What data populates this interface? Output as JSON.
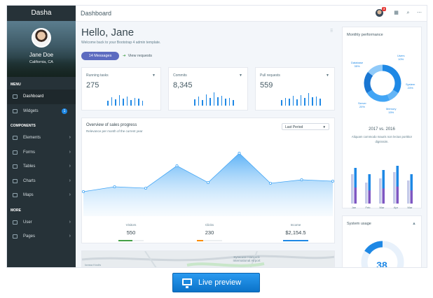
{
  "app": {
    "brand": "Dasha",
    "page_title": "Dashboard"
  },
  "user": {
    "name": "Jane Doe",
    "location": "California, CA",
    "notifications": "3"
  },
  "sidebar": {
    "menu_header": "MENU",
    "components_header": "COMPONENTS",
    "more_header": "MORE",
    "items": [
      {
        "label": "Dashboard"
      },
      {
        "label": "Widgets",
        "badge": "1"
      },
      {
        "label": "Elements"
      },
      {
        "label": "Forms"
      },
      {
        "label": "Tables"
      },
      {
        "label": "Charts"
      },
      {
        "label": "Maps"
      },
      {
        "label": "User"
      },
      {
        "label": "Pages"
      }
    ]
  },
  "main": {
    "greeting": "Hello, Jane",
    "welcome": "Welcome back to your Bootstrap 4 admin template.",
    "messages_button": "14 Messages",
    "view_requests": "View requests"
  },
  "cards": [
    {
      "label": "Running tasks",
      "value": "275"
    },
    {
      "label": "Commits",
      "value": "8,345"
    },
    {
      "label": "Pull requests",
      "value": "559"
    }
  ],
  "overview": {
    "title": "Overview of sales progress",
    "subtitle": "Relevance per month of the current year",
    "period": "Last Period",
    "stats": [
      {
        "label": "Visitors",
        "value": "550",
        "color": "#43a047",
        "fill": 0.55
      },
      {
        "label": "Clicks",
        "value": "230",
        "color": "#fb8c00",
        "fill": 0.25
      },
      {
        "label": "Income",
        "value": "$2,154.5",
        "color": "#1e88e5",
        "fill": 1.0
      }
    ]
  },
  "map_labels": {
    "city": "Syracuse Hancock International Airport",
    "left": "Iorasa Knolls"
  },
  "monthly": {
    "title": "Monthly performance",
    "legend": [
      {
        "label": "Database",
        "pct": "35%"
      },
      {
        "label": "Users",
        "pct": "10%"
      },
      {
        "label": "System",
        "pct": "23%"
      },
      {
        "label": "Server",
        "pct": "20%"
      },
      {
        "label": "Memory",
        "pct": "15%"
      }
    ],
    "compare_title": "2017 vs. 2016",
    "compare_desc": "Aliquam commodo mauris non lectus porttitor dignissim.",
    "bar_months": [
      "Jan",
      "Feb",
      "Mar",
      "Apr",
      "Mar"
    ]
  },
  "system_usage": {
    "title": "System usage",
    "value": "38"
  },
  "preview_button": "Live preview",
  "colors": {
    "sidebar": "#263238",
    "accent": "#1e88e5",
    "button": "#5c6bc0"
  },
  "chart_data": [
    {
      "type": "area",
      "title": "Overview of sales progress",
      "x": [
        1,
        2,
        3,
        4,
        5,
        6,
        7,
        8,
        9
      ],
      "values": [
        35,
        42,
        40,
        72,
        48,
        90,
        47,
        52,
        50
      ],
      "ylim": [
        0,
        100
      ]
    },
    {
      "type": "pie",
      "title": "Monthly performance",
      "categories": [
        "Database",
        "Users",
        "System",
        "Server",
        "Memory"
      ],
      "values": [
        35,
        10,
        23,
        20,
        15
      ]
    },
    {
      "type": "bar",
      "title": "2017 vs. 2016",
      "categories": [
        "Jan",
        "Feb",
        "Mar",
        "Apr",
        "Mar"
      ],
      "series": [
        {
          "values": [
            70,
            50,
            60,
            75,
            55
          ]
        },
        {
          "values": [
            85,
            70,
            80,
            90,
            70
          ]
        }
      ]
    },
    {
      "type": "bar",
      "title": "Running tasks",
      "values": [
        30,
        55,
        40,
        70,
        45,
        60,
        35,
        50,
        45,
        30
      ]
    },
    {
      "type": "bar",
      "title": "Commits",
      "values": [
        40,
        60,
        35,
        75,
        50,
        85,
        55,
        65,
        45,
        50,
        35
      ]
    },
    {
      "type": "bar",
      "title": "Pull requests",
      "values": [
        35,
        50,
        45,
        65,
        40,
        70,
        50,
        80,
        55,
        60,
        45
      ]
    }
  ]
}
